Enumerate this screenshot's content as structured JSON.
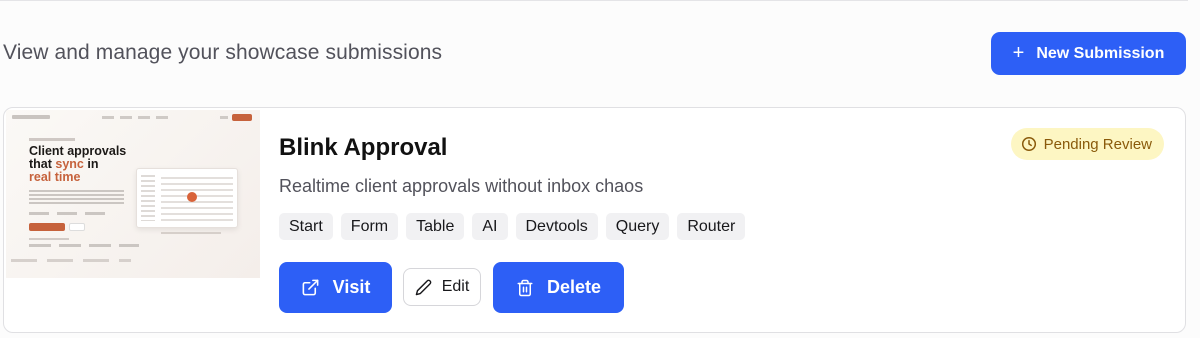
{
  "header": {
    "subtitle": "View and manage your showcase submissions",
    "new_button_label": "New Submission",
    "new_button_icon": "plus-icon"
  },
  "submission": {
    "title": "Blink Approval",
    "description": "Realtime client approvals without inbox chaos",
    "status": "Pending Review",
    "status_icon": "clock-icon",
    "thumbnail": {
      "hero_line1": "Client approvals",
      "hero_line2_prefix": "that ",
      "hero_line2_accent": "sync",
      "hero_line2_suffix": " in",
      "hero_line3": "real time"
    },
    "tags": [
      "Start",
      "Form",
      "Table",
      "AI",
      "Devtools",
      "Query",
      "Router"
    ],
    "actions": {
      "visit": "Visit",
      "edit": "Edit",
      "delete": "Delete"
    }
  },
  "colors": {
    "primary": "#2d5ff6",
    "badge_bg": "#fdf6c3",
    "badge_text": "#8a5a0b",
    "thumbnail_accent": "#c6623c"
  }
}
